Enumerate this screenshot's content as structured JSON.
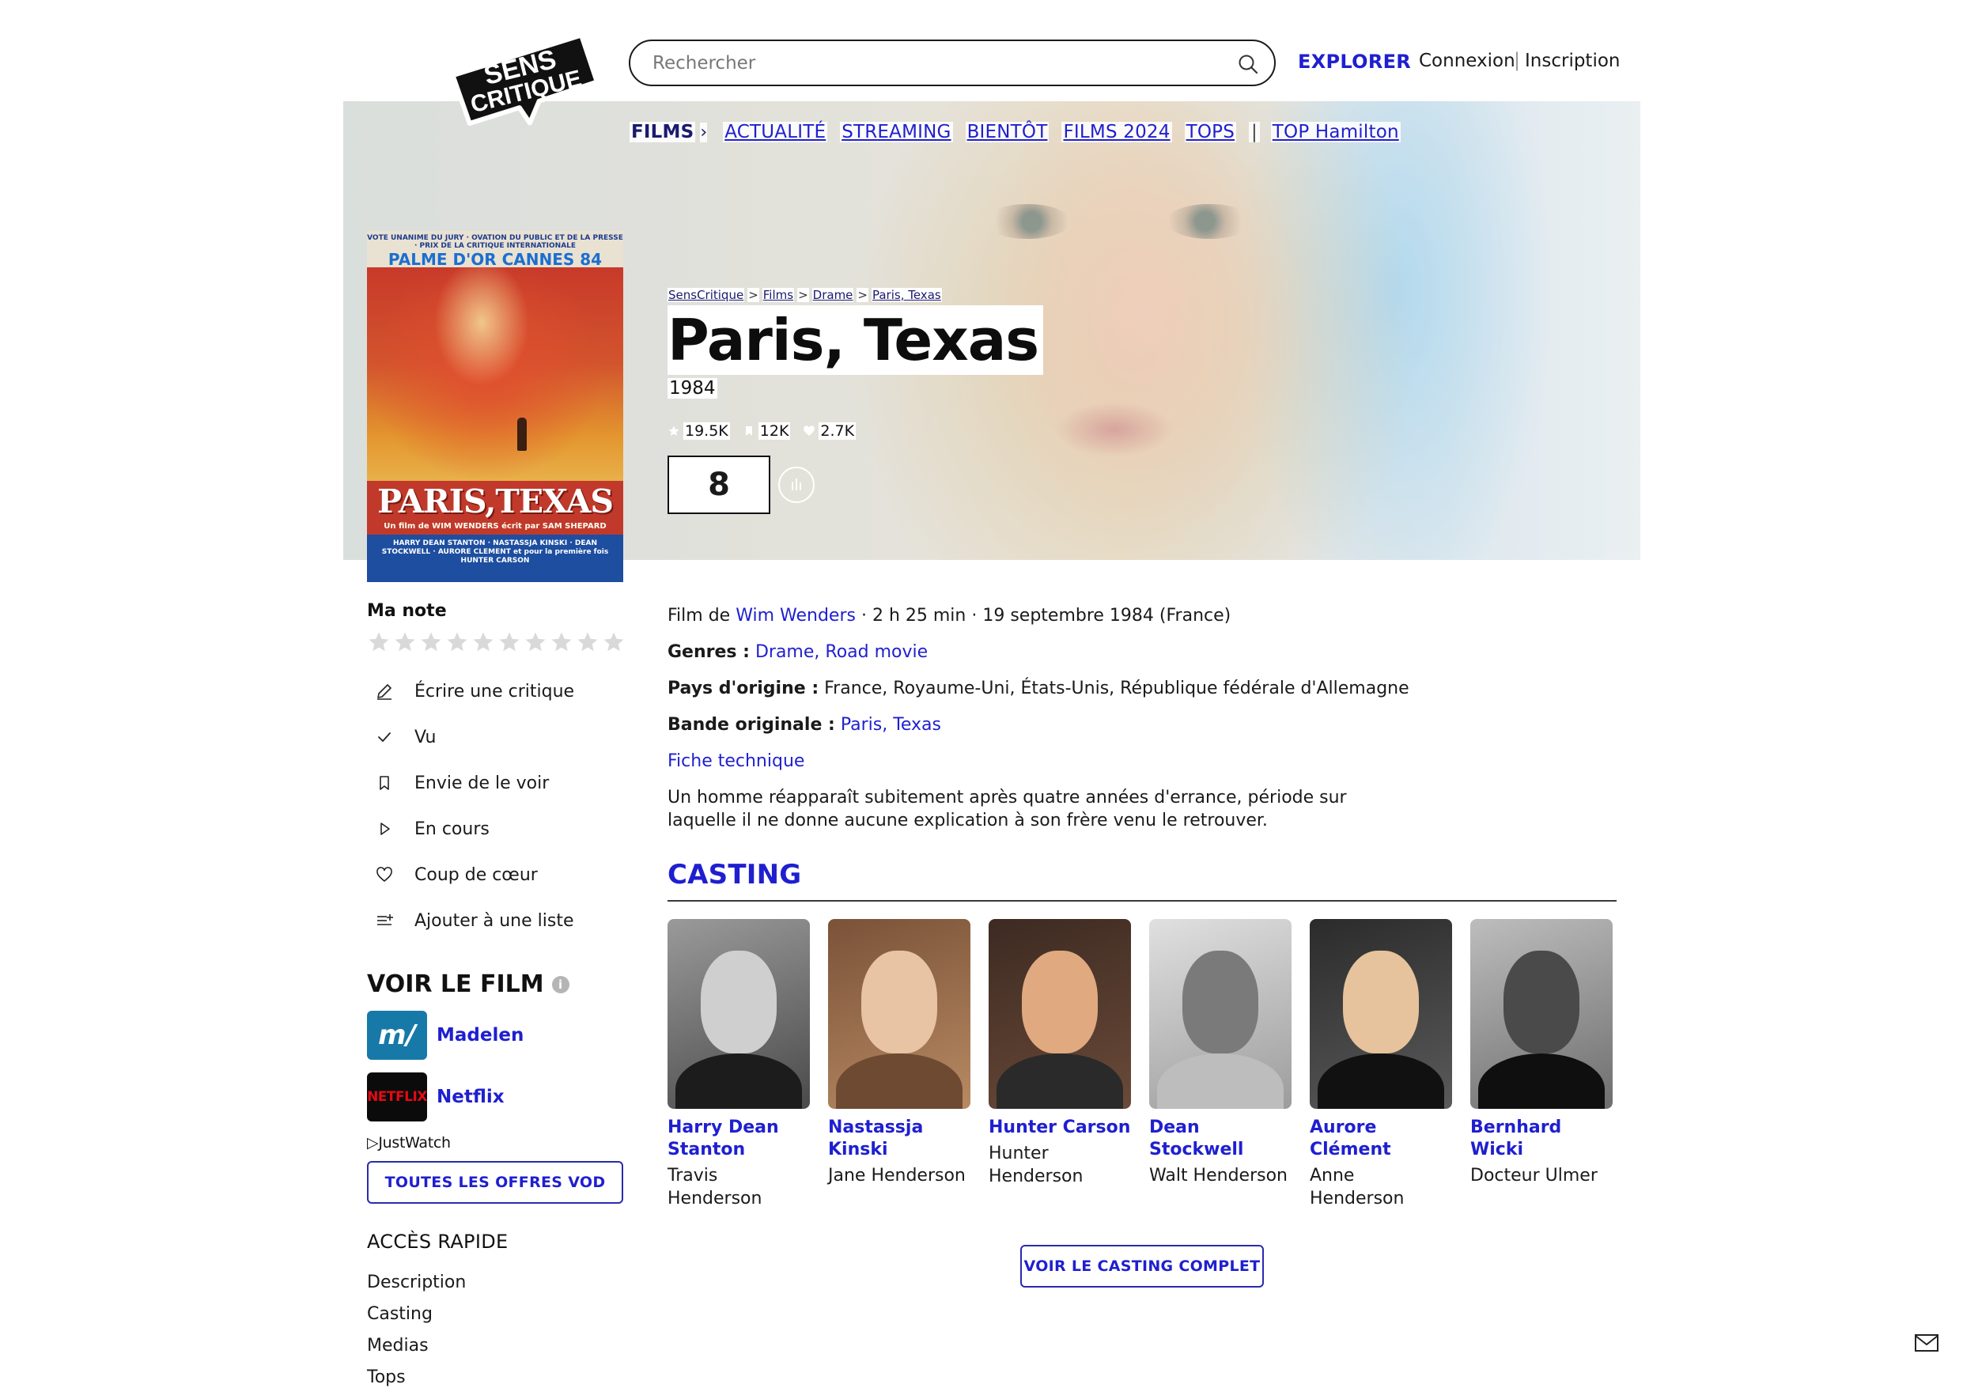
{
  "header": {
    "logo_text_1": "SENS",
    "logo_text_2": "CRITIQUE",
    "search_placeholder": "Rechercher",
    "explore": "EXPLORER",
    "login": "Connexion",
    "separator": "|",
    "signup": "Inscription"
  },
  "nav": {
    "films": "FILMS",
    "chevron": "›",
    "actualite": "ACTUALITÉ",
    "streaming": "STREAMING",
    "bientot": "BIENTÔT",
    "films2024": "FILMS 2024",
    "tops": "TOPS",
    "separator": "|",
    "top_hamilton": "TOP Hamilton"
  },
  "breadcrumb": {
    "items": [
      "SensCritique",
      "Films",
      "Drame",
      "Paris, Texas"
    ],
    "separator": ">"
  },
  "movie": {
    "title": "Paris, Texas",
    "year": "1984",
    "ratings_count": "19.5K",
    "wishlist_count": "12K",
    "favorites_count": "2.7K",
    "score": "8",
    "director_prefix": "Film de",
    "director": "Wim Wenders",
    "meta_suffix": "· 2 h 25 min · 19 septembre 1984 (France)",
    "genres_label": "Genres :",
    "genres": [
      "Drame",
      "Road movie"
    ],
    "genres_sep": ",",
    "origin_label": "Pays d'origine :",
    "origin": "France, Royaume-Uni, États-Unis, République fédérale d'Allemagne",
    "soundtrack_label": "Bande originale :",
    "soundtrack": "Paris, Texas",
    "tech_sheet": "Fiche technique",
    "synopsis": "Un homme réapparaît subitement après quatre années d'errance, période sur laquelle il ne donne aucune explication à son frère venu le retrouver."
  },
  "poster": {
    "top_line": "VOTE UNANIME DU JURY · OVATION DU PUBLIC ET DE LA PRESSE · PRIX DE LA CRITIQUE INTERNATIONALE",
    "palme": "PALME D'OR CANNES 84",
    "title": "PARIS,TEXAS",
    "credit": "Un film de WIM WENDERS écrit par SAM SHEPARD",
    "cast": "HARRY DEAN STANTON · NASTASSJA KINSKI · DEAN STOCKWELL · AURORE CLEMENT et pour la première fois HUNTER CARSON"
  },
  "left": {
    "ma_note": "Ma note",
    "star_count": 10,
    "actions": [
      {
        "label": "Écrire une critique",
        "icon": "pencil-icon"
      },
      {
        "label": "Vu",
        "icon": "check-icon"
      },
      {
        "label": "Envie de le voir",
        "icon": "bookmark-icon"
      },
      {
        "label": "En cours",
        "icon": "play-icon"
      },
      {
        "label": "Coup de cœur",
        "icon": "heart-icon"
      },
      {
        "label": "Ajouter à une liste",
        "icon": "list-add-icon"
      }
    ],
    "voir_le_film": "VOIR LE FILM",
    "info": "i",
    "providers": [
      {
        "name": "Madelen",
        "logo": "m/"
      },
      {
        "name": "Netflix",
        "logo": "NETFLIX"
      }
    ],
    "justwatch": "JustWatch",
    "vod_button": "TOUTES LES OFFRES VOD",
    "acces_rapide": "ACCÈS RAPIDE",
    "acces_items": [
      "Description",
      "Casting",
      "Medias",
      "Tops"
    ]
  },
  "casting": {
    "title": "CASTING",
    "button": "VOIR LE CASTING COMPLET",
    "members": [
      {
        "name": "Harry Dean Stanton",
        "role": "Travis Henderson",
        "bw": true
      },
      {
        "name": "Nastassja Kinski",
        "role": "Jane Henderson",
        "bw": false
      },
      {
        "name": "Hunter Carson",
        "role": "Hunter Henderson",
        "bw": false
      },
      {
        "name": "Dean Stockwell",
        "role": "Walt Henderson",
        "bw": true
      },
      {
        "name": "Aurore Clément",
        "role": "Anne Henderson",
        "bw": false
      },
      {
        "name": "Bernhard Wicki",
        "role": "Docteur Ulmer",
        "bw": true
      }
    ]
  },
  "colors": {
    "accent": "#1f1fd0",
    "text": "#1a1a1a",
    "nav_dark": "#1a1a6e"
  }
}
